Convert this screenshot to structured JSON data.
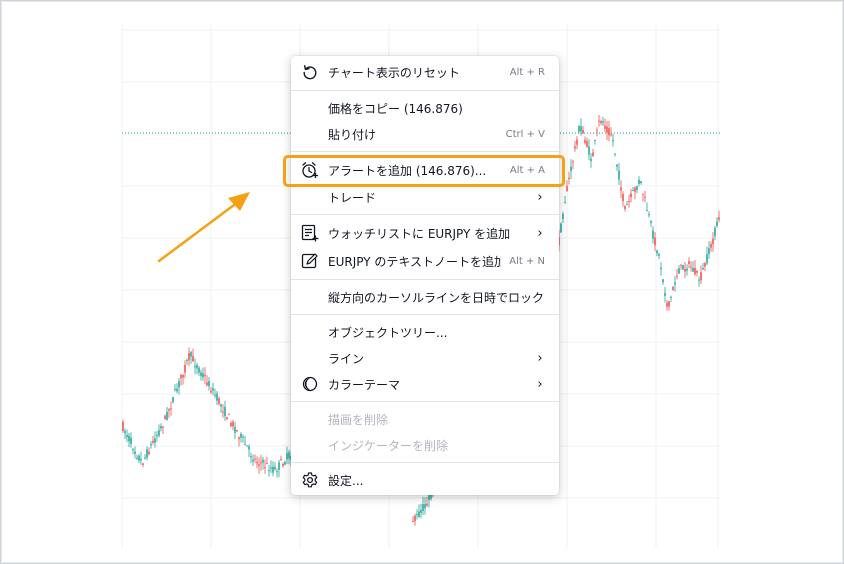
{
  "colors": {
    "up_candle": "#26a69a",
    "down_candle": "#ef5350",
    "highlight": "#f5a114",
    "price_line": "#26a69a",
    "grid": "#eef0f3"
  },
  "menu": {
    "items": [
      {
        "id": "reset",
        "label": "チャート表示のリセット",
        "shortcut": "Alt + R",
        "icon": "reset-icon"
      },
      {
        "sep": true
      },
      {
        "id": "copy-price",
        "label": "価格をコピー (146.876)"
      },
      {
        "id": "paste",
        "label": "貼り付け",
        "shortcut": "Ctrl + V"
      },
      {
        "sep": true
      },
      {
        "id": "add-alert",
        "label": "アラートを追加 (146.876)...",
        "shortcut": "Alt + A",
        "icon": "alarm-clock-icon",
        "highlighted": true
      },
      {
        "id": "trade",
        "label": "トレード",
        "submenu": true
      },
      {
        "sep": true
      },
      {
        "id": "watchlist",
        "label": "ウォッチリストに EURJPY を追加",
        "submenu": true,
        "icon": "watchlist-add-icon"
      },
      {
        "id": "text-note",
        "label": "EURJPY のテキストノートを追加",
        "shortcut": "Alt + N",
        "icon": "edit-note-icon"
      },
      {
        "sep": true
      },
      {
        "id": "lock-cursor",
        "label": "縦方向のカーソルラインを日時でロック"
      },
      {
        "sep": true
      },
      {
        "id": "object-tree",
        "label": "オブジェクトツリー..."
      },
      {
        "id": "line",
        "label": "ライン",
        "submenu": true
      },
      {
        "id": "color-theme",
        "label": "カラーテーマ",
        "submenu": true,
        "icon": "moon-icon"
      },
      {
        "sep": true
      },
      {
        "id": "remove-drawings",
        "label": "描画を削除",
        "disabled": true
      },
      {
        "id": "remove-indicators",
        "label": "インジケーターを削除",
        "disabled": true
      },
      {
        "sep": true
      },
      {
        "id": "settings",
        "label": "設定...",
        "icon": "gear-icon"
      }
    ],
    "submenu_glyph": "›"
  },
  "pointer": {
    "icon": "arrow-pointer-icon"
  }
}
